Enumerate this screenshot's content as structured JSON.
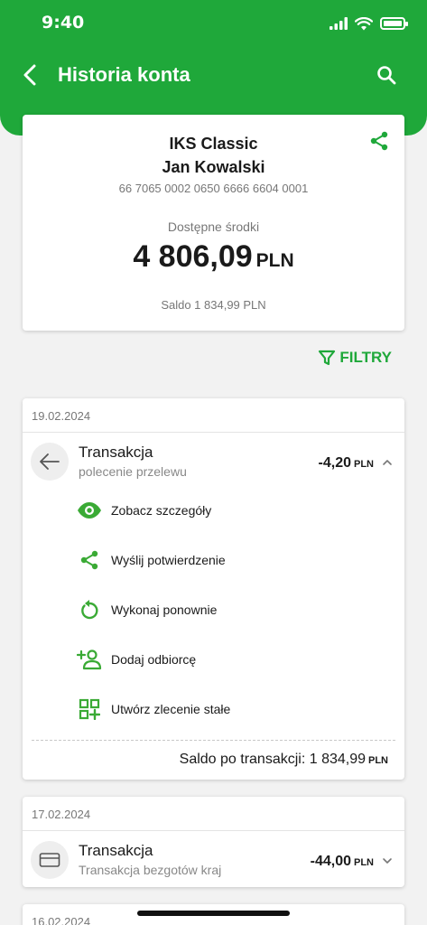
{
  "status_bar": {
    "time": "9:40"
  },
  "header": {
    "title": "Historia konta"
  },
  "colors": {
    "brand": "#1fa83a",
    "background": "#f2f2f2"
  },
  "account": {
    "name": "IKS Classic",
    "owner": "Jan Kowalski",
    "number": "66 7065 0002 0650 6666 6604 0001",
    "available_label": "Dostępne środki",
    "available_amount": "4 806,09",
    "currency": "PLN",
    "saldo": "Saldo 1 834,99 PLN"
  },
  "filters": {
    "label": "FILTRY"
  },
  "groups": [
    {
      "date": "19.02.2024",
      "transaction": {
        "title": "Transakcja",
        "subtitle": "polecenie przelewu",
        "amount": "-4,20",
        "currency": "PLN",
        "icon": "arrow-left-icon",
        "expanded": true
      },
      "actions": [
        {
          "label": "Zobacz szczegóły",
          "icon": "eye-icon"
        },
        {
          "label": "Wyślij potwierdzenie",
          "icon": "share-icon"
        },
        {
          "label": "Wykonaj ponownie",
          "icon": "repeat-icon"
        },
        {
          "label": "Dodaj odbiorcę",
          "icon": "add-person-icon"
        },
        {
          "label": "Utwórz zlecenie stałe",
          "icon": "grid-plus-icon"
        }
      ],
      "saldo_after_label": "Saldo po transakcji: 1 834,99",
      "saldo_after_currency": "PLN"
    },
    {
      "date": "17.02.2024",
      "transaction": {
        "title": "Transakcja",
        "subtitle": "Transakcja bezgotów kraj",
        "amount": "-44,00",
        "currency": "PLN",
        "icon": "card-icon",
        "expanded": false
      }
    },
    {
      "date": "16.02.2024"
    }
  ]
}
